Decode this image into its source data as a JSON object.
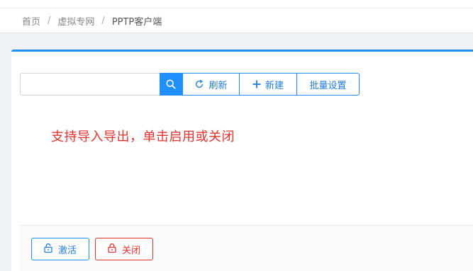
{
  "breadcrumb": {
    "items": [
      "首页",
      "虚拟专网",
      "PPTP客户端"
    ],
    "separator": "/"
  },
  "toolbar": {
    "search_value": "",
    "search_placeholder": "",
    "refresh_label": "刷新",
    "new_label": "新建",
    "batch_label": "批量设置"
  },
  "note": {
    "text": "支持导入导出，单击启用或关闭"
  },
  "footer": {
    "activate_label": "激活",
    "close_label": "关闭"
  },
  "colors": {
    "accent": "#1e90ff",
    "danger": "#e5322d",
    "background": "#f0f2f5"
  },
  "icons": {
    "search": "search-icon",
    "refresh": "refresh-icon",
    "plus": "plus-icon",
    "unlock": "unlock-icon",
    "lock": "lock-icon"
  }
}
